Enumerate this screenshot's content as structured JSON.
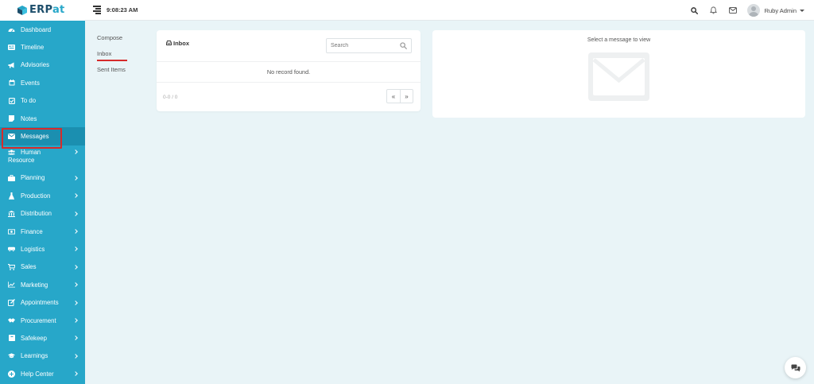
{
  "app": {
    "logo_prefix": "ERP",
    "logo_suffix": "at",
    "clock": "9:08:23 AM"
  },
  "user": {
    "name": "Ruby Admin"
  },
  "sidebar": {
    "items": [
      {
        "label": "Dashboard",
        "icon": "dashboard-icon",
        "submenu": false
      },
      {
        "label": "Timeline",
        "icon": "timeline-icon",
        "submenu": false
      },
      {
        "label": "Advisories",
        "icon": "megaphone-icon",
        "submenu": false
      },
      {
        "label": "Events",
        "icon": "calendar-icon",
        "submenu": false
      },
      {
        "label": "To do",
        "icon": "checkbox-icon",
        "submenu": false
      },
      {
        "label": "Notes",
        "icon": "note-icon",
        "submenu": false
      },
      {
        "label": "Messages",
        "icon": "envelope-icon",
        "submenu": false,
        "active": true
      },
      {
        "label_line1": "Human",
        "label_line2": "Resource",
        "icon": "users-icon",
        "submenu": true
      },
      {
        "label": "Planning",
        "icon": "briefcase-icon",
        "submenu": true
      },
      {
        "label": "Production",
        "icon": "flask-icon",
        "submenu": true
      },
      {
        "label": "Distribution",
        "icon": "bank-icon",
        "submenu": true
      },
      {
        "label": "Finance",
        "icon": "money-icon",
        "submenu": true
      },
      {
        "label": "Logistics",
        "icon": "truck-icon",
        "submenu": true
      },
      {
        "label": "Sales",
        "icon": "cart-icon",
        "submenu": true
      },
      {
        "label": "Marketing",
        "icon": "chart-icon",
        "submenu": true
      },
      {
        "label": "Appointments",
        "icon": "edit-icon",
        "submenu": true
      },
      {
        "label": "Procurement",
        "icon": "handshake-icon",
        "submenu": true
      },
      {
        "label": "Safekeep",
        "icon": "archive-icon",
        "submenu": true
      },
      {
        "label": "Learnings",
        "icon": "graduation-cap-icon",
        "submenu": true
      },
      {
        "label": "Help Center",
        "icon": "plus-circle-icon",
        "submenu": true
      }
    ]
  },
  "folders": {
    "compose": "Compose",
    "inbox": "Inbox",
    "sent": "Sent Items"
  },
  "inbox": {
    "title": "Inbox",
    "search_placeholder": "Search",
    "empty_message": "No record found.",
    "pagination": "0-0 / 0",
    "prev": "«",
    "next": "»"
  },
  "preview": {
    "placeholder": "Select a message to view"
  },
  "colors": {
    "sidebar": "#27a7c9",
    "sidebar_active": "#1b8fb0",
    "highlight": "#d62b2b",
    "background": "#e9f4f7"
  }
}
